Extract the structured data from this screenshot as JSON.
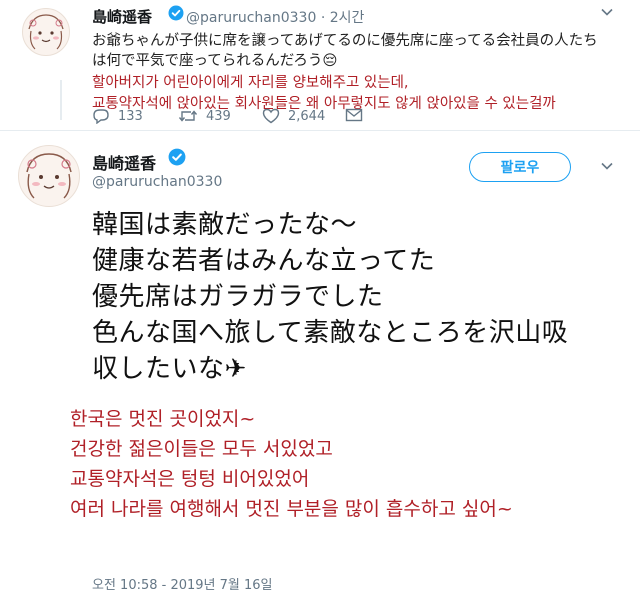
{
  "tweet_top": {
    "name": "島崎遥香",
    "handle": "@paruruchan0330",
    "time": "2시간",
    "meta_sep": " · ",
    "text_jp_line1": "お爺ちゃんが子供に席を譲ってあげてるのに優先席に座ってる会社員の人たち",
    "text_jp_line2": "は何で平気で座ってられるんだろう😔",
    "translation_line1": "할아버지가 어린아이에게 자리를 양보해주고 있는데,",
    "translation_line2": "교통약자석에 앉아있는 회사원들은 왜 아무렇지도 않게 앉아있을 수 있는걸까",
    "replies": "133",
    "retweets": "439",
    "likes": "2,644",
    "menu_icon": "chevron-down-icon"
  },
  "tweet_main": {
    "name": "島崎遥香",
    "handle": "@paruruchan0330",
    "follow_label": "팔로우",
    "text_jp": [
      "韓国は素敵だったな〜",
      "健康な若者はみんな立ってた",
      "優先席はガラガラでした",
      "色んな国へ旅して素敵なところを沢山吸",
      "収したいな✈"
    ],
    "translation": [
      "한국은 멋진 곳이었지~",
      "건강한 젊은이들은 모두 서있었고",
      "교통약자석은 텅텅 비어있었어",
      "여러 나라를 여행해서 멋진 부분을 많이 흡수하고 싶어~"
    ],
    "timestamp": "오전 10:58 - 2019년 7월 16일"
  },
  "colors": {
    "accent": "#1da1f2",
    "translation_red": "#b02027",
    "muted": "#657786"
  }
}
